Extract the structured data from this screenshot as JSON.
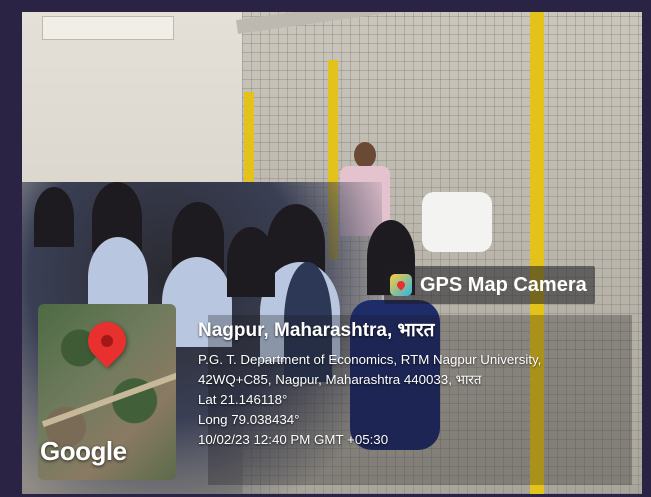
{
  "photo": {
    "description_icons": [
      "map-pin-icon",
      "gps-camera-app-icon"
    ]
  },
  "overlay": {
    "app_name": "GPS Map Camera",
    "map_logo": "Google",
    "place": "Nagpur, Maharashtra, भारत",
    "address_line1": "P.G. T. Department of Economics, RTM Nagpur University,",
    "address_line2": "42WQ+C85, Nagpur, Maharashtra 440033, भारत",
    "lat": "Lat 21.146118°",
    "long": "Long 79.038434°",
    "datetime": "10/02/23 12:40 PM GMT +05:30"
  },
  "colors": {
    "frame": "#2a2343",
    "pin": "#e8312f",
    "post": "#e3c21b"
  }
}
